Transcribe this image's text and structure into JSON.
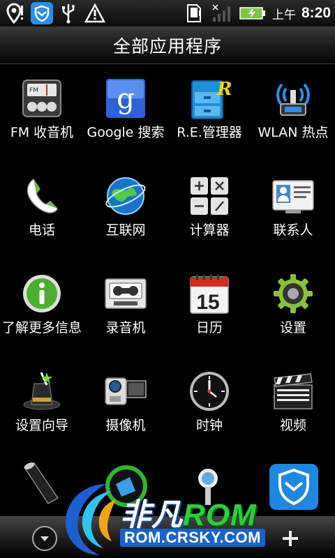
{
  "status_bar": {
    "icons": [
      "location-pin-icon",
      "shield-app-icon",
      "usb-icon",
      "warning-icon",
      "sd-card-icon",
      "signal-icon",
      "battery-charging-icon"
    ],
    "ampm": "上午",
    "time": "8:20"
  },
  "title": "全部应用程序",
  "apps": [
    {
      "label": "FM 收音机",
      "icon": "fm-radio-icon"
    },
    {
      "label": "Google 搜索",
      "icon": "google-search-icon"
    },
    {
      "label": "R.E.管理器",
      "icon": "re-manager-icon"
    },
    {
      "label": "WLAN 热点",
      "icon": "wlan-hotspot-icon"
    },
    {
      "label": "电话",
      "icon": "phone-icon"
    },
    {
      "label": "互联网",
      "icon": "internet-globe-icon"
    },
    {
      "label": "计算器",
      "icon": "calculator-icon"
    },
    {
      "label": "联系人",
      "icon": "contacts-icon"
    },
    {
      "label": "了解更多信息",
      "icon": "info-icon"
    },
    {
      "label": "录音机",
      "icon": "voice-recorder-icon"
    },
    {
      "label": "日历",
      "icon": "calendar-icon",
      "date": "15"
    },
    {
      "label": "设置",
      "icon": "settings-gear-icon"
    },
    {
      "label": "设置向导",
      "icon": "setup-wizard-icon"
    },
    {
      "label": "摄像机",
      "icon": "camcorder-icon"
    },
    {
      "label": "时钟",
      "icon": "clock-icon"
    },
    {
      "label": "视频",
      "icon": "video-clapper-icon"
    }
  ],
  "partial_row_icons": [
    "flashlight-icon",
    "green-app-icon",
    "search-app-icon",
    "shield-app-icon"
  ],
  "dock": {
    "left_icon": "chevron-down-icon",
    "right_icon": "plus-icon"
  },
  "watermark": {
    "brand_cn": "非凡",
    "brand_en": "ROM",
    "url": "ROM.CRSKY.COM"
  },
  "colors": {
    "accent_blue": "#1764c8",
    "accent_green": "#2ecc40"
  }
}
